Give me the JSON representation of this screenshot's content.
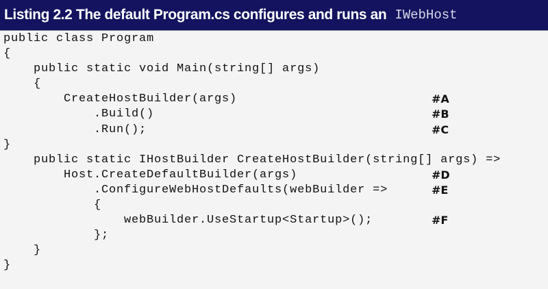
{
  "header": {
    "title": "Listing 2.2 The default Program.cs configures and runs an",
    "title_code": "IWebHost"
  },
  "lines": [
    {
      "text": "public class Program",
      "ann": ""
    },
    {
      "text": "{",
      "ann": ""
    },
    {
      "text": "    public static void Main(string[] args)",
      "ann": ""
    },
    {
      "text": "    {",
      "ann": ""
    },
    {
      "text": "        CreateHostBuilder(args)",
      "ann": "#A"
    },
    {
      "text": "            .Build()",
      "ann": "#B"
    },
    {
      "text": "            .Run();",
      "ann": "#C"
    },
    {
      "text": "}",
      "ann": ""
    },
    {
      "text": "    public static IHostBuilder CreateHostBuilder(string[] args) =>",
      "ann": ""
    },
    {
      "text": "        Host.CreateDefaultBuilder(args)",
      "ann": "#D"
    },
    {
      "text": "            .ConfigureWebHostDefaults(webBuilder =>",
      "ann": "#E"
    },
    {
      "text": "            {",
      "ann": ""
    },
    {
      "text": "                webBuilder.UseStartup<Startup>();",
      "ann": "#F"
    },
    {
      "text": "            };",
      "ann": ""
    },
    {
      "text": "    }",
      "ann": ""
    },
    {
      "text": "}",
      "ann": ""
    }
  ]
}
